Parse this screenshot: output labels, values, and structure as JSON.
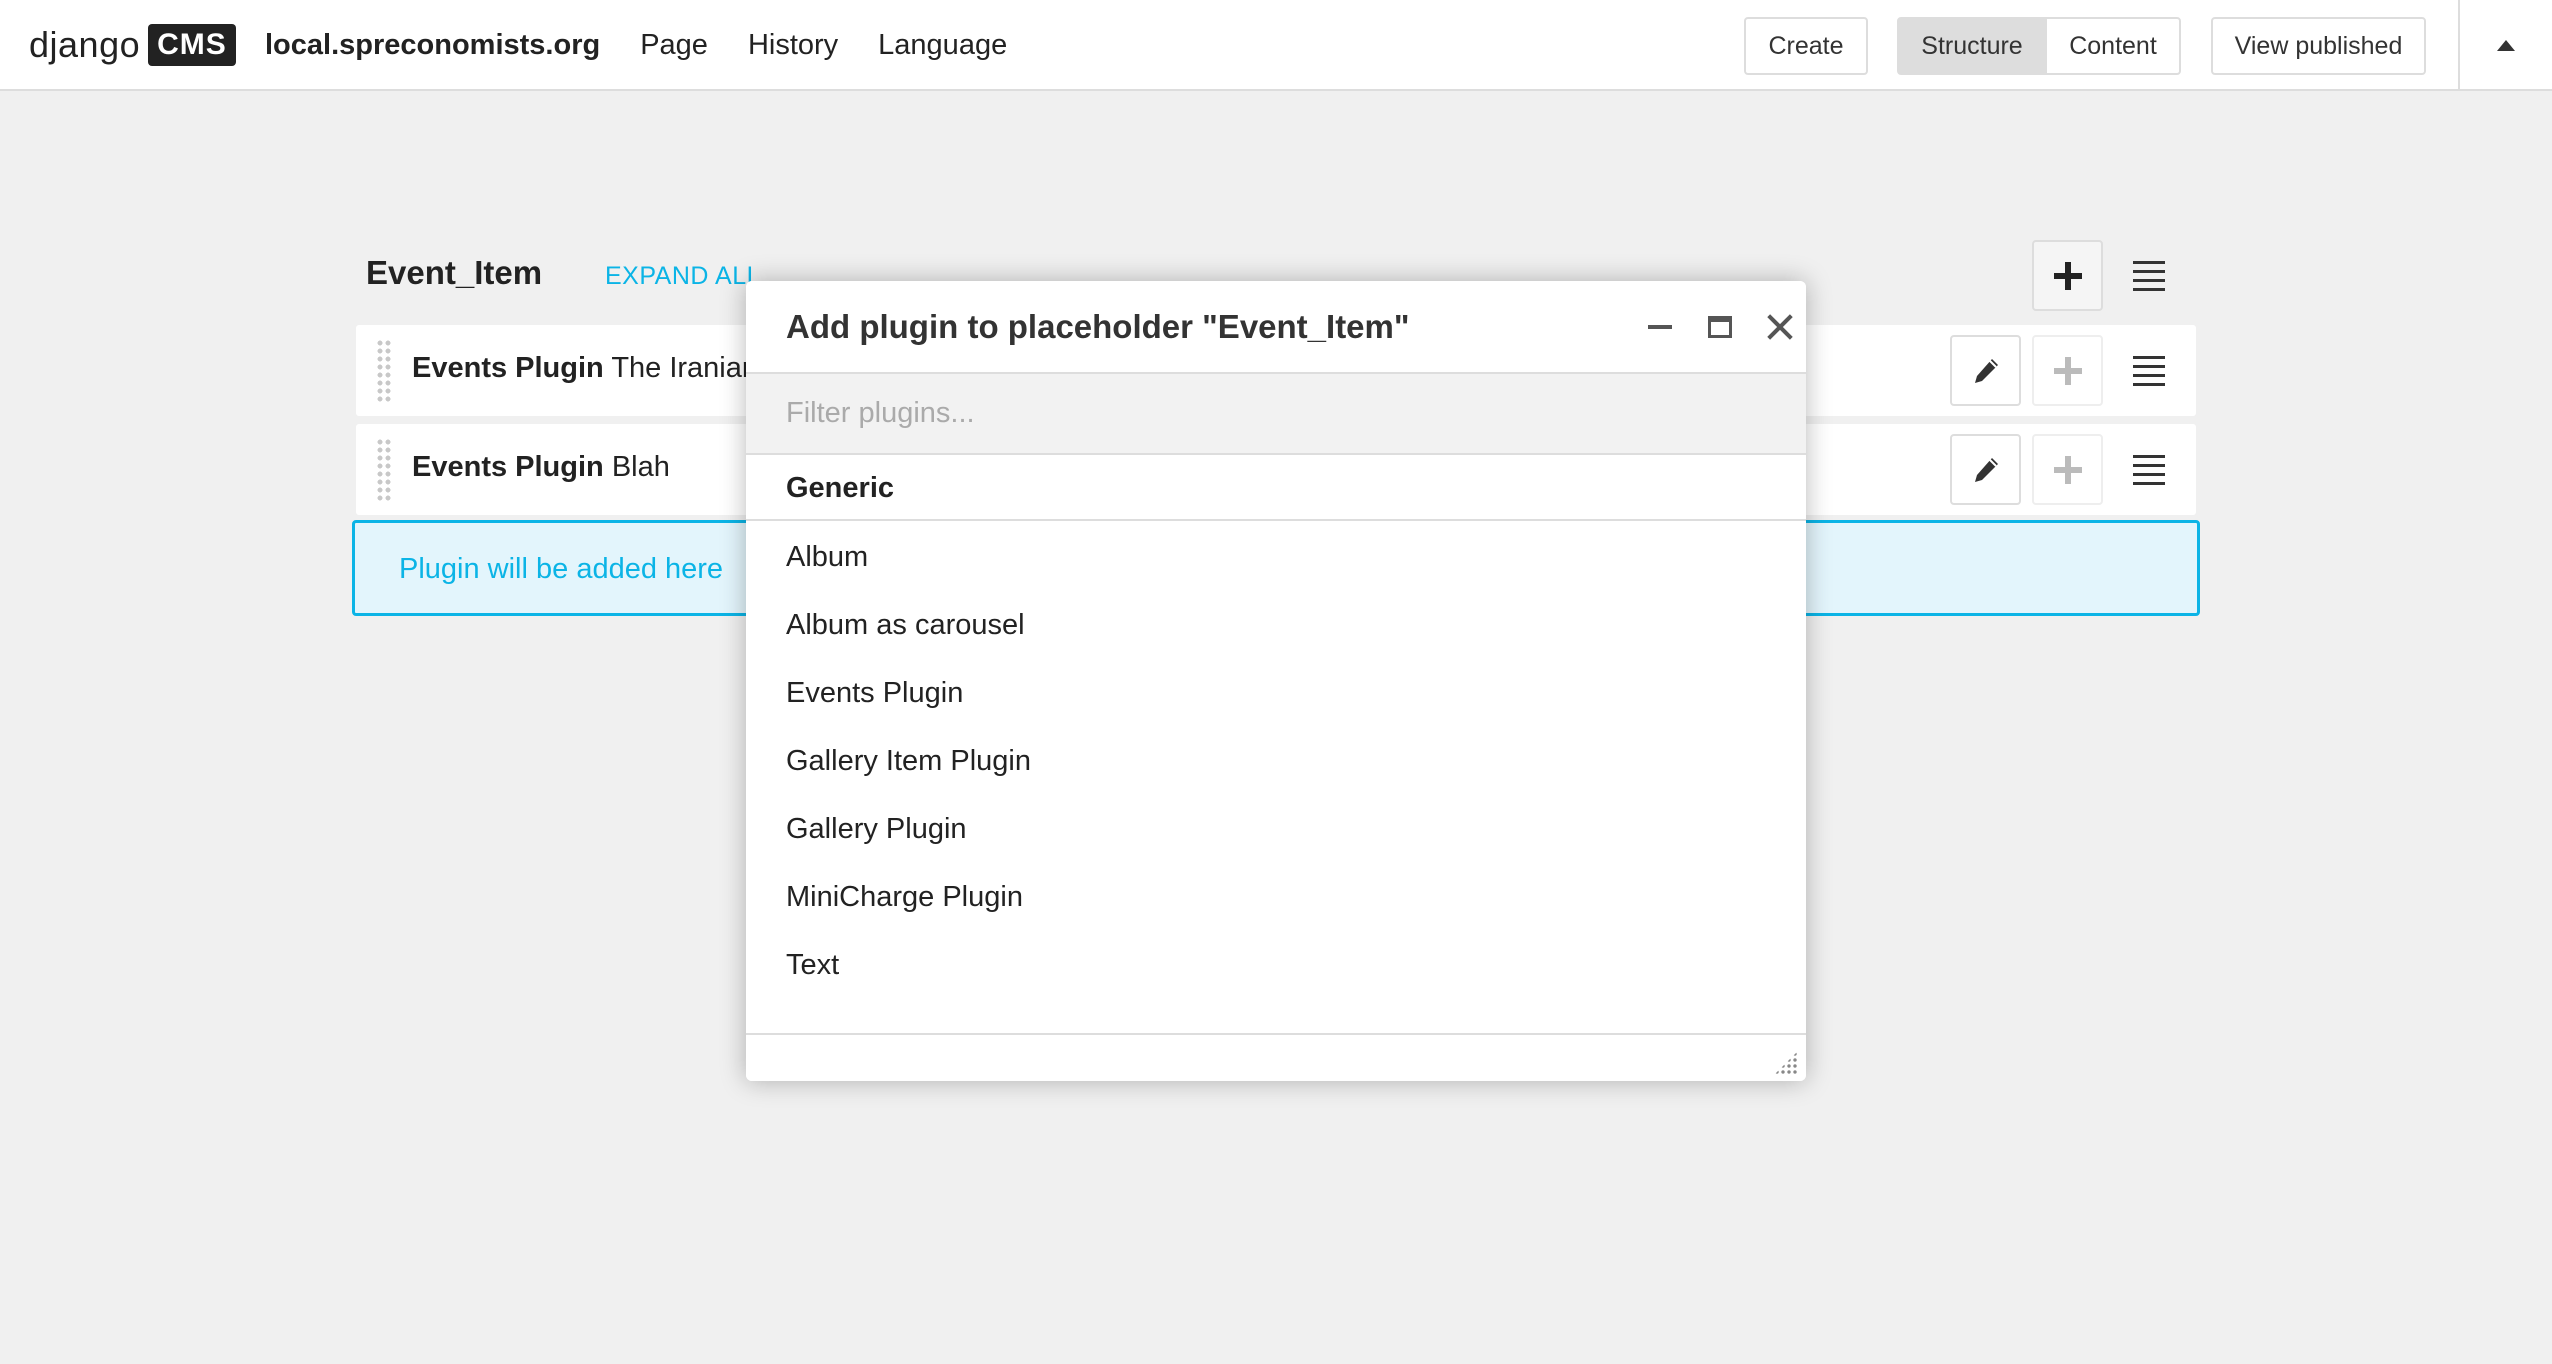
{
  "toolbar": {
    "logo_word": "django",
    "logo_badge": "CMS",
    "site": "local.spreconomists.org",
    "menu": [
      "Page",
      "History",
      "Language"
    ],
    "create_label": "Create",
    "structure_label": "Structure",
    "content_label": "Content",
    "view_published_label": "View published"
  },
  "structure": {
    "placeholder_title": "Event_Item",
    "expand_all": "EXPAND ALL",
    "plugins": [
      {
        "type": "Events Plugin",
        "name": "The Iranian"
      },
      {
        "type": "Events Plugin",
        "name": "Blah"
      }
    ],
    "dropzone_text": "Plugin will be added here"
  },
  "modal": {
    "title": "Add plugin to placeholder \"Event_Item\"",
    "filter_placeholder": "Filter plugins...",
    "group": "Generic",
    "items": [
      "Album",
      "Album as carousel",
      "Events Plugin",
      "Gallery Item Plugin",
      "Gallery Plugin",
      "MiniCharge Plugin",
      "Text"
    ]
  },
  "colors": {
    "accent": "#0bb4e6",
    "dropzone_bg": "#e3f5fc",
    "board_bg": "#f0f0f0"
  }
}
